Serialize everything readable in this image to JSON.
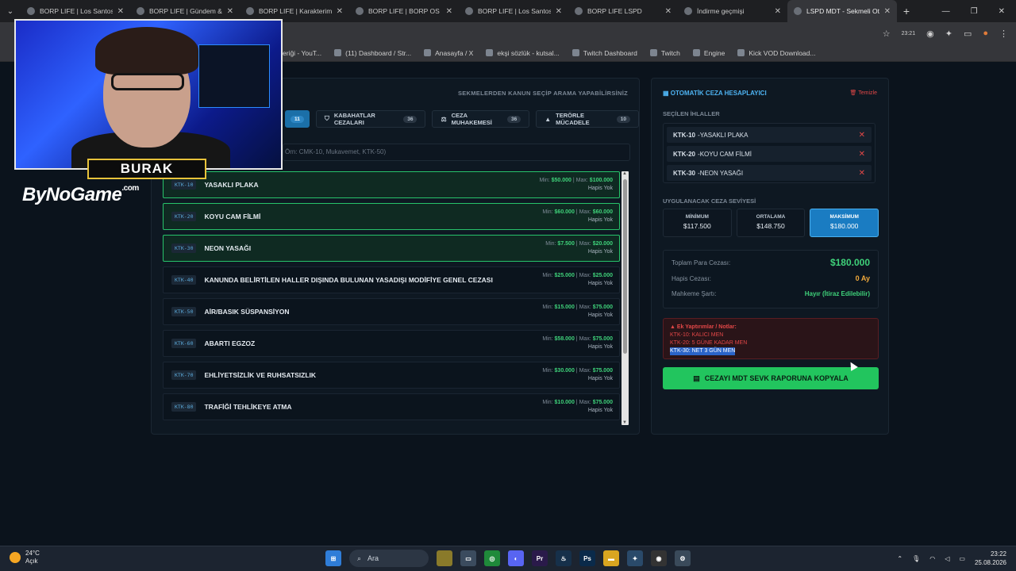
{
  "browser": {
    "tabs": [
      {
        "title": "BORP LIFE | Los Santos Sa...",
        "active": false
      },
      {
        "title": "BORP LIFE | Gündem & Tr...",
        "active": false
      },
      {
        "title": "BORP LIFE | Karakterim &...",
        "active": false
      },
      {
        "title": "BORP LIFE | BORP OS - Şe...",
        "active": false
      },
      {
        "title": "BORP LIFE | Los Santos Sa...",
        "active": false
      },
      {
        "title": "BORP LIFE LSPD",
        "active": false
      },
      {
        "title": "İndirme geçmişi",
        "active": false
      },
      {
        "title": "LSPD MDT - Sekmeli Oto...",
        "active": true
      }
    ],
    "bookmarks": [
      "eriği - YouT...",
      "(11) Dashboard / Str...",
      "Anasayfa / X",
      "ekşi sözlük - kutsal...",
      "Twitch Dashboard",
      "Twitch",
      "Engine",
      "Kick VOD Download..."
    ],
    "profile_time": "23:21"
  },
  "webcam": {
    "name": "BURAK",
    "logo": "ByNoGame",
    "logo_suffix": ".com"
  },
  "mdt": {
    "hint": "SEKMELERDEN KANUN SEÇİP ARAMA YAPABİLİRSİNİZ",
    "categories": [
      {
        "label": "",
        "count": "11",
        "icon": "car-icon",
        "active": true
      },
      {
        "label": "KABAHATLAR CEZALARI",
        "count": "36",
        "icon": "shield-icon",
        "active": false
      },
      {
        "label": "CEZA MUHAKEMESİ",
        "count": "36",
        "icon": "scale-icon",
        "active": false
      },
      {
        "label": "TERÖRLE MÜCADELE",
        "count": "10",
        "icon": "warning-icon",
        "active": false
      }
    ],
    "search_placeholder": "Örn: CMK-10, Mukavemet, KTK-50)",
    "laws": [
      {
        "code": "KTK-10",
        "name": "YASAKLI PLAKA",
        "min": "$50.000",
        "max": "$100.000",
        "jail": "Hapis Yok",
        "selected": true
      },
      {
        "code": "KTK-20",
        "name": "KOYU CAM FİLMİ",
        "min": "$60.000",
        "max": "$60.000",
        "jail": "Hapis Yok",
        "selected": true
      },
      {
        "code": "KTK-30",
        "name": "NEON YASAĞI",
        "min": "$7.500",
        "max": "$20.000",
        "jail": "Hapis Yok",
        "selected": true
      },
      {
        "code": "KTK-40",
        "name": "KANUNDA BELİRTİLEN HALLER DIŞINDA BULUNAN YASADIŞI MODİFİYE GENEL CEZASI",
        "min": "$25.000",
        "max": "$25.000",
        "jail": "Hapis Yok",
        "selected": false
      },
      {
        "code": "KTK-50",
        "name": "AİR/BASIK SÜSPANSİYON",
        "min": "$15.000",
        "max": "$75.000",
        "jail": "Hapis Yok",
        "selected": false
      },
      {
        "code": "KTK-60",
        "name": "ABARTI EGZOZ",
        "min": "$58.000",
        "max": "$75.000",
        "jail": "Hapis Yok",
        "selected": false
      },
      {
        "code": "KTK-70",
        "name": "EHLİYETSİZLİK VE RUHSATSIZLIK",
        "min": "$30.000",
        "max": "$75.000",
        "jail": "Hapis Yok",
        "selected": false
      },
      {
        "code": "KTK-80",
        "name": "TRAFİĞİ TEHLİKEYE ATMA",
        "min": "$10.000",
        "max": "$75.000",
        "jail": "Hapis Yok",
        "selected": false
      }
    ],
    "min_label": "Min:",
    "max_label": "Max:"
  },
  "calculator": {
    "title": "OTOMATİK CEZA HESAPLAYICI",
    "clear": "Temizle",
    "selected_label": "SEÇİLEN İHLALLER",
    "selected": [
      {
        "code": "KTK-10",
        "name": "YASAKLI PLAKA"
      },
      {
        "code": "KTK-20",
        "name": "KOYU CAM FİLMİ"
      },
      {
        "code": "KTK-30",
        "name": "NEON YASAĞI"
      }
    ],
    "level_label": "UYGULANACAK CEZA SEVİYESİ",
    "levels": [
      {
        "name": "MİNİMUM",
        "value": "$117.500",
        "active": false
      },
      {
        "name": "ORTALAMA",
        "value": "$148.750",
        "active": false
      },
      {
        "name": "MAKSİMUM",
        "value": "$180.000",
        "active": true
      }
    ],
    "total_label": "Toplam Para Cezası:",
    "total_value": "$180.000",
    "jail_label": "Hapis Cezası:",
    "jail_value": "0 Ay",
    "court_label": "Mahkeme Şartı:",
    "court_value": "Hayır (İtiraz Edilebilir)",
    "notes_title": "Ek Yaptırımlar / Notlar:",
    "notes": [
      "KTK-10: KALICI MEN",
      "KTK-20: 5 GÜNE KADAR MEN",
      "KTK-30: NET 3 GÜN MEN"
    ],
    "copy_button": "CEZAYI MDT SEVK RAPORUNA KOPYALA"
  },
  "taskbar": {
    "temp": "24°C",
    "weather": "Açık",
    "search": "Ara",
    "time": "23:22",
    "date": "25.08.2026"
  }
}
